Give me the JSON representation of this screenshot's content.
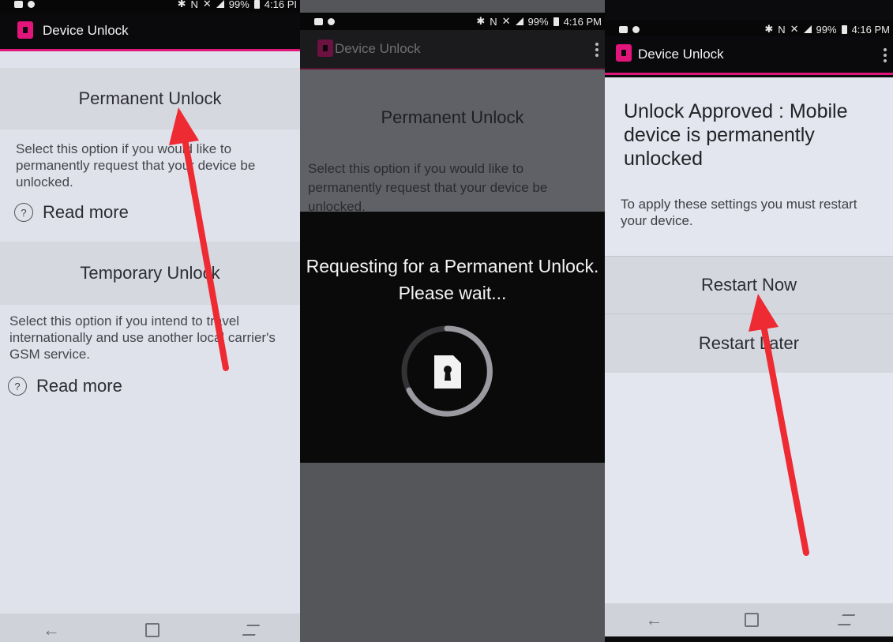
{
  "status_bar": {
    "battery": "99%",
    "time_left": "4:16 PI",
    "time": "4:16 PM"
  },
  "app": {
    "title": "Device Unlock"
  },
  "screen1": {
    "permanent_title": "Permanent Unlock",
    "permanent_desc": "Select this option if you would like to permanently request that your device be unlocked.",
    "temporary_title": "Temporary Unlock",
    "temporary_desc": "Select this option if you intend to travel internationally and use another local carrier's GSM service.",
    "read_more": "Read more"
  },
  "screen2": {
    "card_title": "Permanent Unlock",
    "card_desc": "Select this option if you would like to permanently request that your device be unlocked.",
    "dialog_line1": "Requesting for a Permanent Unlock.",
    "dialog_line2": "Please wait..."
  },
  "screen3": {
    "approved": "Unlock Approved : Mobile device is permanently unlocked",
    "apply": "To apply these settings you must restart your device.",
    "restart_now": "Restart Now",
    "restart_later": "Restart Later"
  },
  "colors": {
    "accent": "#e2157a",
    "arrow": "#ee2a33"
  },
  "icons": [
    "message-icon",
    "bluetooth-icon",
    "nfc-icon",
    "mute-icon",
    "signal-icon",
    "battery-icon",
    "help-circle-icon",
    "back-icon",
    "home-icon",
    "recent-apps-icon",
    "keyhole-sim-icon",
    "overflow-menu-icon"
  ]
}
